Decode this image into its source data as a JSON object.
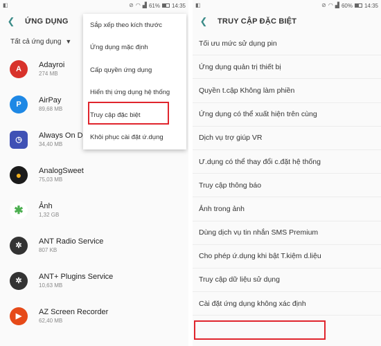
{
  "left": {
    "status": {
      "time": "14:35",
      "battery": "61%",
      "battery_fraction": 0.61
    },
    "title": "ỨNG DỤNG",
    "filter": "Tất cả ứng dụng",
    "apps": [
      {
        "name": "Adayroi",
        "size": "274 MB",
        "icon": "adayroi-icon",
        "color": "#d8322b",
        "glyph": "A"
      },
      {
        "name": "AirPay",
        "size": "89,68 MB",
        "icon": "airpay-icon",
        "color": "#1e88e5",
        "glyph": "P"
      },
      {
        "name": "Always On D",
        "size": "34,40 MB",
        "icon": "always-on-display-icon",
        "color": "#3f51b5",
        "glyph": "◷"
      },
      {
        "name": "AnalogSweet",
        "size": "75,03 MB",
        "icon": "analogsweet-icon",
        "color": "#1b1b1b",
        "glyph": "●"
      },
      {
        "name": "Ảnh",
        "size": "1,32 GB",
        "icon": "photos-icon",
        "color": "#ffffff",
        "glyph": "✱"
      },
      {
        "name": "ANT Radio Service",
        "size": "807 KB",
        "icon": "ant-radio-icon",
        "color": "#333333",
        "glyph": "✲"
      },
      {
        "name": "ANT+ Plugins Service",
        "size": "10,63 MB",
        "icon": "ant-plugins-icon",
        "color": "#333333",
        "glyph": "✲"
      },
      {
        "name": "AZ Screen Recorder",
        "size": "62,40 MB",
        "icon": "az-recorder-icon",
        "color": "#e64a19",
        "glyph": "▶"
      }
    ],
    "menu": [
      "Sắp xếp theo kích thước",
      "Ứng dụng mặc định",
      "Cấp quyền ứng dụng",
      "Hiển thị ứng dụng hệ thống",
      "Truy cập đặc biệt",
      "Khôi phục cài đặt ứ.dụng"
    ]
  },
  "right": {
    "status": {
      "time": "14:35",
      "battery": "60%",
      "battery_fraction": 0.6
    },
    "title": "TRUY CẬP ĐẶC BIỆT",
    "items": [
      "Tối ưu mức sử dụng pin",
      "Ứng dụng quản trị thiết bị",
      "Quyền t.cập Không làm phiền",
      "Ứng dụng có thể xuất hiện trên cùng",
      "Dịch vụ trợ giúp VR",
      "Ư.dụng có thể thay đổi c.đặt hệ thống",
      "Truy cập thông báo",
      "Ảnh trong ảnh",
      "Dùng dịch vụ tin nhắn SMS Premium",
      "Cho phép ứ.dụng khi bật T.kiệm d.liệu",
      "Truy cập dữ liệu sử dụng",
      "Cài đặt ứng dụng không xác định"
    ]
  },
  "colors": {
    "accent": "#3b8b88",
    "highlight": "#e0242c"
  }
}
